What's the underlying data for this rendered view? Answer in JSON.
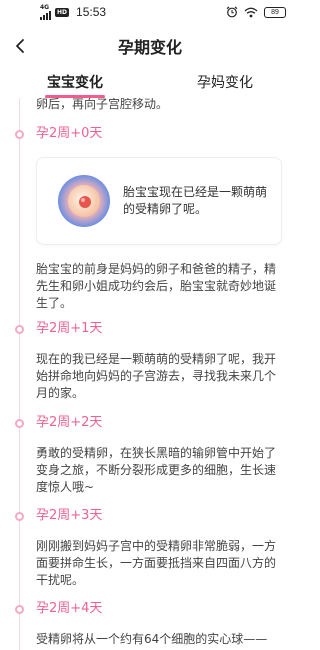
{
  "status_bar": {
    "signal_label": "4G",
    "hd_label": "HD",
    "time": "15:53",
    "battery": "89"
  },
  "nav": {
    "title": "孕期变化"
  },
  "tabs": [
    {
      "label": "宝宝变化",
      "active": true
    },
    {
      "label": "孕妈变化",
      "active": false
    }
  ],
  "timeline": {
    "intro_text": "卵后，再向子宫腔移动。",
    "entries": [
      {
        "day": "孕2周+0天",
        "card_text": "胎宝宝现在已经是一颗萌萌的受精卵了呢。",
        "text": "胎宝宝的前身是妈妈的卵子和爸爸的精子，精先生和卵小姐成功约会后，胎宝宝就奇妙地诞生了。"
      },
      {
        "day": "孕2周+1天",
        "text": "现在的我已经是一颗萌萌的受精卵了呢，我开始拼命地向妈妈的子宫游去，寻找我未来几个月的家。"
      },
      {
        "day": "孕2周+2天",
        "text": "勇敢的受精卵，在狭长黑暗的输卵管中开始了变身之旅，不断分裂形成更多的细胞，生长速度惊人哦~"
      },
      {
        "day": "孕2周+3天",
        "text": "刚刚搬到妈妈子宫中的受精卵非常脆弱，一方面要拼命生长，一方面要抵挡来自四面八方的干扰呢。"
      },
      {
        "day": "孕2周+4天",
        "text": "受精卵将从一个约有64个细胞的实心球——"
      }
    ]
  },
  "colors": {
    "accent": "#f25b8c",
    "day_label": "#f0628f",
    "timeline_dot": "#f7a9c3"
  }
}
